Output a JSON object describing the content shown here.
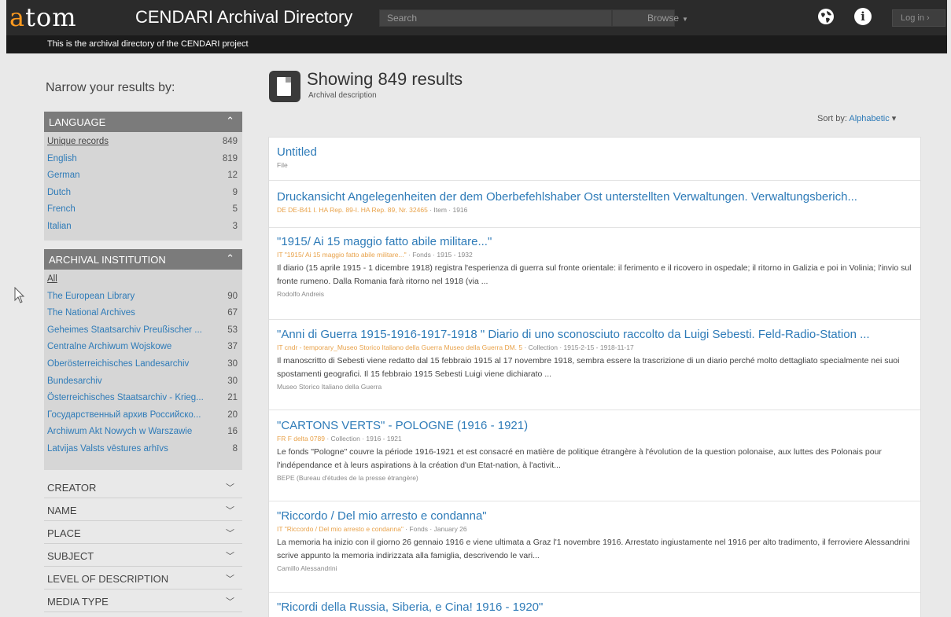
{
  "header": {
    "logo": {
      "accent": "a",
      "rest": "tom"
    },
    "site_title": "CENDARI Archival Directory",
    "search_placeholder": "Search",
    "browse_label": "Browse",
    "login_label": "Log in",
    "tagline": "This is the archival directory of the CENDARI project"
  },
  "sidebar": {
    "heading": "Narrow your results by:",
    "language": {
      "title": "LANGUAGE",
      "items": [
        {
          "label": "Unique records",
          "count": "849"
        },
        {
          "label": "English",
          "count": "819"
        },
        {
          "label": "German",
          "count": "12"
        },
        {
          "label": "Dutch",
          "count": "9"
        },
        {
          "label": "French",
          "count": "5"
        },
        {
          "label": "Italian",
          "count": "3"
        }
      ]
    },
    "institution": {
      "title": "ARCHIVAL INSTITUTION",
      "all_label": "All",
      "items": [
        {
          "label": "The European Library",
          "count": "90"
        },
        {
          "label": "The National Archives",
          "count": "67"
        },
        {
          "label": "Geheimes Staatsarchiv Preußischer ...",
          "count": "53"
        },
        {
          "label": "Centralne Archiwum Wojskowe",
          "count": "37"
        },
        {
          "label": "Oberösterreichisches Landesarchiv",
          "count": "30"
        },
        {
          "label": "Bundesarchiv",
          "count": "30"
        },
        {
          "label": "Österreichisches Staatsarchiv - Krieg...",
          "count": "21"
        },
        {
          "label": "Государственный архив Российско...",
          "count": "20"
        },
        {
          "label": "Archiwum Akt Nowych w Warszawie",
          "count": "16"
        },
        {
          "label": "Latvijas Valsts vēstures arhīvs",
          "count": "8"
        }
      ]
    },
    "closed_facets": [
      "CREATOR",
      "NAME",
      "PLACE",
      "SUBJECT",
      "LEVEL OF DESCRIPTION",
      "MEDIA TYPE"
    ]
  },
  "main": {
    "showing": "Showing 849 results",
    "subtitle": "Archival description",
    "sort_label": "Sort by:",
    "sort_value": "Alphabetic",
    "results": [
      {
        "title": "Untitled",
        "ref": "",
        "meta": "File",
        "desc": "",
        "creator": ""
      },
      {
        "title": "Druckansicht Angelegenheiten der dem Oberbefehlshaber Ost unterstellten Verwaltungen. Verwaltungsberich...",
        "ref": "DE DE-B41 I. HA Rep. 89-I. HA Rep. 89, Nr. 32465",
        "meta": " · Item · 1916",
        "desc": "",
        "creator": ""
      },
      {
        "title": "\"1915/ Ai 15 maggio fatto abile militare...\"",
        "ref": "IT \"1915/ Ai 15 maggio fatto abile militare...\"",
        "meta": " · Fonds · 1915 - 1932",
        "desc": "Il diario (15 aprile 1915 - 1 dicembre 1918) registra l'esperienza di guerra sul fronte orientale: il ferimento e il ricovero in ospedale; il ritorno in Galizia e poi in Volinia; l'invio sul fronte rumeno. Dalla Romania farà ritorno nel 1918 (via ...",
        "creator": "Rodolfo Andreis"
      },
      {
        "title": "\"Anni di Guerra 1915-1916-1917-1918 \" Diario di uno sconosciuto raccolto da Luigi Sebesti. Feld-Radio-Station ...",
        "ref": "IT cndr - temporary_Museo Storico Italiano della Guerra Museo della Guerra DM. 5",
        "meta": " · Collection · 1915-2-15 - 1918-11-17",
        "desc": "Il manoscritto di Sebesti viene redatto dal 15 febbraio 1915 al 17 novembre 1918, sembra essere la trascrizione di un diario perché molto dettagliato specialmente nei suoi spostamenti geografici. Il 15 febbraio 1915 Sebesti Luigi viene dichiarato ...",
        "creator": "Museo Storico Italiano della Guerra"
      },
      {
        "title": "\"CARTONS VERTS\" - POLOGNE (1916 - 1921)",
        "ref": "FR F delta 0789",
        "meta": " · Collection · 1916 - 1921",
        "desc": "Le fonds \"Pologne\" couvre la période 1916-1921 et est consacré en matière de politique étrangère à l'évolution de la question polonaise, aux luttes des Polonais pour l'indépendance et à leurs aspirations à la création d'un Etat-nation, à l'activit...",
        "creator": "BEPE (Bureau d'études de la presse étrangère)"
      },
      {
        "title": "\"Riccordo / Del mio arresto e condanna\"",
        "ref": "IT \"Riccordo / Del mio arresto e condanna\"",
        "meta": " · Fonds · January 26",
        "desc": "La memoria ha inizio con il giorno 26 gennaio 1916 e viene ultimata a Graz l'1 novembre 1916. Arrestato ingiustamente nel 1916 per alto tradimento, il ferroviere Alessandrini scrive appunto la memoria indirizzata alla famiglia, descrivendo le vari...",
        "creator": "Camillo Alessandrini"
      },
      {
        "title": "\"Ricordi della Russia, Siberia, e Cina! 1916 - 1920\"",
        "ref": "",
        "meta": "",
        "desc": "",
        "creator": ""
      }
    ]
  },
  "colors": {
    "link": "#2e7bb8",
    "accent": "#ff9a1f",
    "ref": "#e8a24a",
    "header_bg": "#2b2b2b"
  }
}
